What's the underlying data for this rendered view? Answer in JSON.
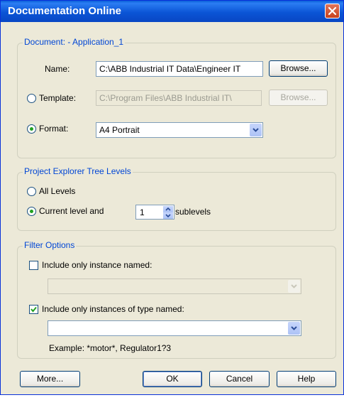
{
  "window": {
    "title": "Documentation Online"
  },
  "document_group": {
    "legend": "Document: - Application_1",
    "name_label": "Name:",
    "name_value": "C:\\ABB Industrial IT Data\\Engineer IT",
    "template_label": "Template:",
    "template_value": "C:\\Program Files\\ABB Industrial IT\\",
    "format_label": "Format:",
    "format_value": "A4 Portrait",
    "browse_label": "Browse...",
    "browse_template_label": "Browse..."
  },
  "tree_group": {
    "legend": "Project Explorer Tree Levels",
    "all_levels_label": "All Levels",
    "current_level_label": "Current level and",
    "sublevels_value": "1",
    "sublevels_label": "sublevels"
  },
  "filter_group": {
    "legend": "Filter Options",
    "instance_named_label": "Include only instance named:",
    "instance_named_checked": false,
    "type_named_label": "Include only instances of type named:",
    "type_named_checked": true,
    "type_named_value": "",
    "example_text": "Example: *motor*, Regulator1?3"
  },
  "buttons": {
    "more": "More...",
    "ok": "OK",
    "cancel": "Cancel",
    "help": "Help"
  },
  "colors": {
    "title_bar": "#0a5fd8",
    "legend_text": "#0046d5",
    "dialog_bg": "#ece9d8",
    "close_button": "#c9411b",
    "check_green": "#21a121"
  },
  "icons": [
    "close-icon",
    "checkmark-icon",
    "dropdown-arrow-icon",
    "spin-up-icon",
    "spin-down-icon"
  ]
}
